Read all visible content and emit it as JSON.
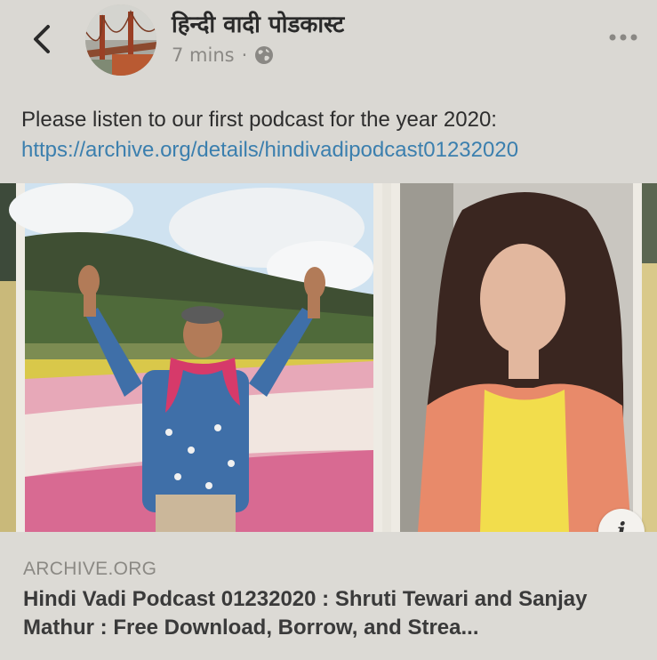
{
  "header": {
    "page_name": "हिन्दी वादी पोडकास्ट",
    "time": "7 mins",
    "separator": "·",
    "privacy_icon": "globe-icon",
    "back_icon": "chevron-left-icon",
    "more_icon": "more-dots-icon"
  },
  "post": {
    "text": "Please listen to our first podcast for the year 2020:",
    "link": "https://archive.org/details/hindivadipodcast01232020"
  },
  "preview": {
    "domain": "ARCHIVE.ORG",
    "title": "Hindi Vadi Podcast 01232020 : Shruti Tewari and Sanjay Mathur : Free Download, Borrow, and Strea...",
    "info_label": "i"
  },
  "colors": {
    "background": "#dad8d3",
    "link": "#3b7fae",
    "meta_text": "#8a8884"
  }
}
